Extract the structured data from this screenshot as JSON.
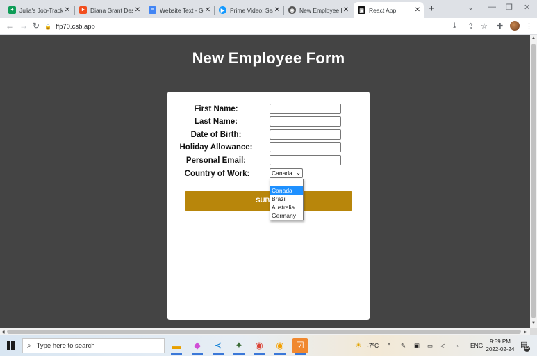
{
  "browser": {
    "tabs": [
      {
        "title": "Julia's Job-Tracking",
        "favicon_color": "#0f9d58",
        "favicon_glyph": "+",
        "icon": "sheets-icon"
      },
      {
        "title": "Diana Grant Design",
        "favicon_color": "#f24e1e",
        "favicon_glyph": "F",
        "icon": "figma-icon"
      },
      {
        "title": "Website Text - Goo",
        "favicon_color": "#4285f4",
        "favicon_glyph": "≡",
        "icon": "docs-icon"
      },
      {
        "title": "Prime Video: Search",
        "favicon_color": "#1399ff",
        "favicon_glyph": "▶",
        "icon": "prime-video-icon"
      },
      {
        "title": "New Employee Form",
        "favicon_color": "#555555",
        "favicon_glyph": "◉",
        "icon": "codesandbox-icon"
      },
      {
        "title": "React App",
        "favicon_color": "#111111",
        "favicon_glyph": "▣",
        "icon": "react-app-icon",
        "active": true
      }
    ],
    "url": "ffp70.csb.app"
  },
  "page": {
    "heading": "New Employee Form",
    "fields": [
      {
        "label": "First Name:",
        "value": ""
      },
      {
        "label": "Last Name:",
        "value": ""
      },
      {
        "label": "Date of Birth:",
        "value": ""
      },
      {
        "label": "Holiday Allowance:",
        "value": ""
      },
      {
        "label": "Personal Email:",
        "value": ""
      }
    ],
    "country": {
      "label": "Country of Work:",
      "selected": "Canada",
      "options": [
        "Canada",
        "Brazil",
        "Australia",
        "Germany"
      ]
    },
    "submit_label": "SUBMIT"
  },
  "taskbar": {
    "search_placeholder": "Type here to search",
    "weather": "-7°C",
    "language": "ENG",
    "time": "9:59 PM",
    "date": "2022-02-24",
    "notifications": "12"
  },
  "colors": {
    "accent": "#b8860b",
    "page_background": "#444444",
    "dropdown_highlight": "#1e90ff"
  }
}
